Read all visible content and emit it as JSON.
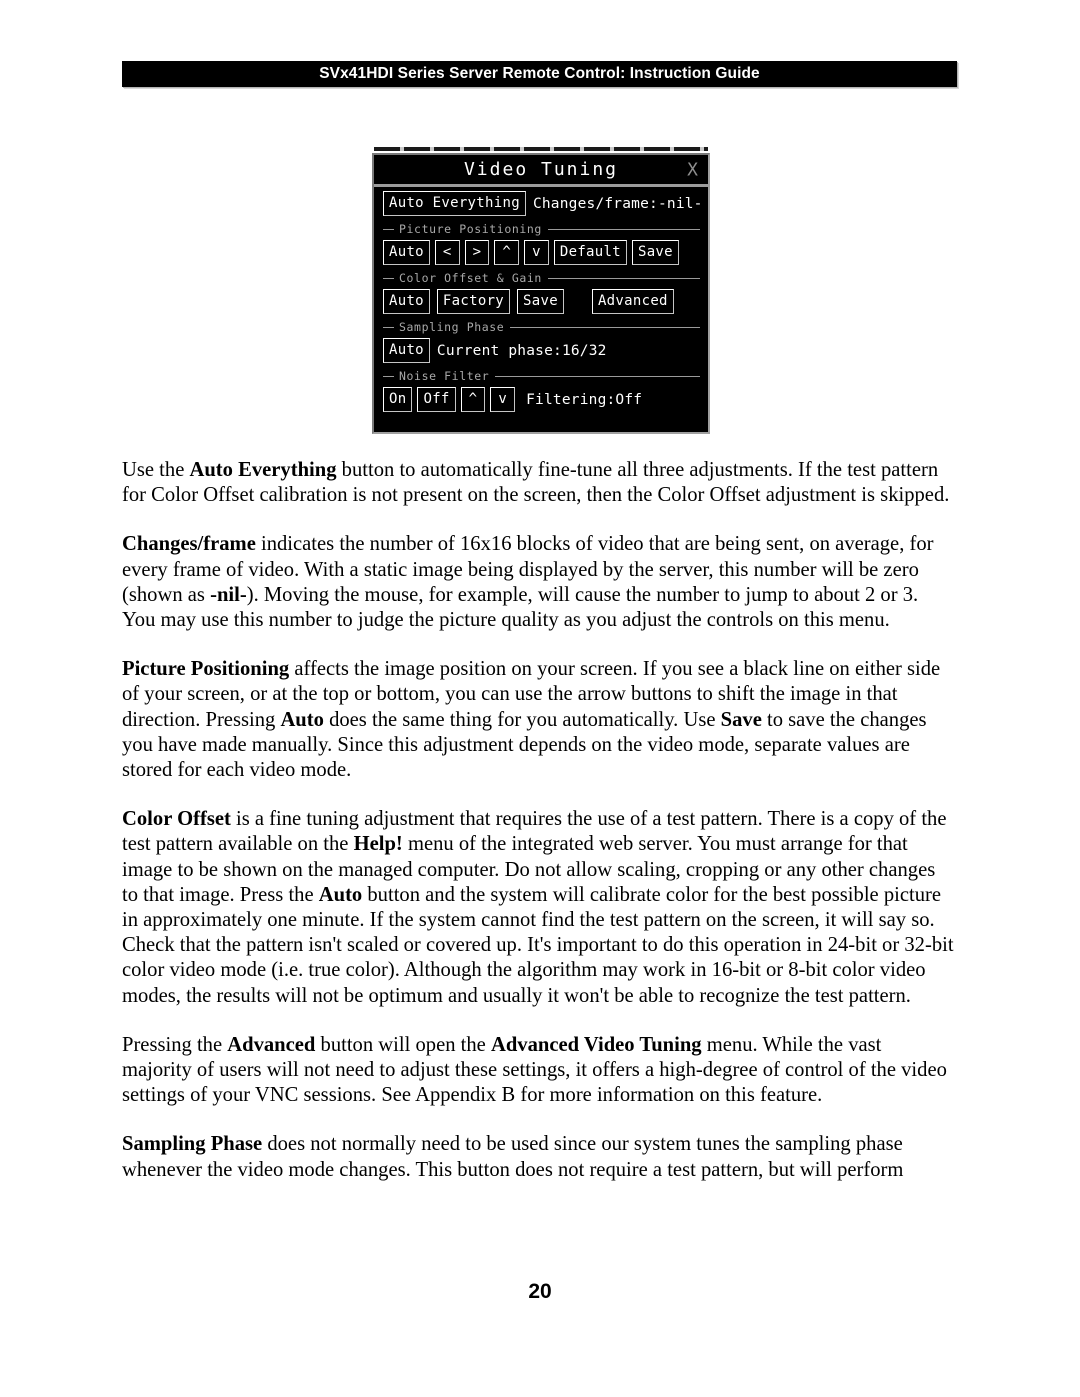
{
  "header": {
    "title": "SVx41HDI Series Server Remote Control: Instruction Guide"
  },
  "dialog": {
    "title": "Video Tuning",
    "close_label": "X",
    "row_auto_everything": {
      "button": "Auto Everything",
      "status": "Changes/frame:-nil-"
    },
    "groups": [
      {
        "caption": "Picture Positioning",
        "buttons": [
          "Auto",
          "<",
          ">",
          "^",
          "v",
          "Default",
          "Save"
        ]
      },
      {
        "caption": "Color Offset & Gain",
        "buttons": [
          "Auto",
          "Factory",
          "Save",
          "Advanced"
        ]
      },
      {
        "caption": "Sampling Phase",
        "buttons": [
          "Auto"
        ],
        "status": "Current phase:16/32"
      },
      {
        "caption": "Noise Filter",
        "buttons": [
          "On",
          "Off",
          "^",
          "v"
        ],
        "status": "Filtering:Off"
      }
    ]
  },
  "body": {
    "paragraphs": [
      {
        "id": "p-auto-everything",
        "html": "Use the <b>Auto Everything</b> button to automatically fine-tune all three adjustments. If the test pattern for Color Offset calibration is not present on the screen, then the Color Offset adjustment is skipped."
      },
      {
        "id": "p-changes-frame",
        "html": "<b>Changes/frame</b> indicates the number of 16x16 blocks of video that are being sent, on average, for every frame of video. With a static image being displayed by the server, this number will be zero (shown as <b>-nil-</b>). Moving the mouse, for example, will cause the number to jump to about 2 or 3. You may use this number to judge the picture quality as you adjust the controls on this menu."
      },
      {
        "id": "p-picture-positioning",
        "html": "<b>Picture Positioning</b> affects the image position on your screen. If you see a black line on either side of your screen, or at the top or bottom, you can use the arrow buttons to shift the image in that direction. Pressing <b>Auto</b> does the same thing for you automatically. Use <b>Save</b> to save the changes you have made manually. Since this adjustment depends on the video mode, separate values are stored for each video mode."
      },
      {
        "id": "p-color-offset",
        "html": "<b>Color Offset</b> is a fine tuning adjustment that requires the use of a test pattern.  There is a copy of the test pattern available on the <b>Help!</b> menu of the integrated web server. You must arrange for that image to be shown on the managed computer.  Do not allow scaling, cropping or any other changes to that image. Press the <b>Auto</b> button and the system will calibrate color for the best possible picture in approximately one minute. If the system cannot find the test pattern on the screen, it will say so.  Check that the pattern isn't scaled or covered up. It's important to do this operation in 24-bit or 32-bit color video mode (i.e. true color). Although the algorithm may work in 16-bit or 8-bit color video modes, the results will not be optimum and usually it won't be able to recognize the test pattern."
      },
      {
        "id": "p-advanced",
        "html": "Pressing the <b>Advanced</b> button will open the <b>Advanced Video Tuning</b> menu.  While the vast majority of users will not need to adjust these settings, it offers a high-degree of control of the video settings of your VNC sessions.  See Appendix B for more information on this feature."
      },
      {
        "id": "p-sampling-phase",
        "html": "<b>Sampling Phase</b> does not normally need to be used since our system tunes the sampling phase whenever the video mode changes. This button does not require a test pattern, but will perform"
      }
    ]
  },
  "footer": {
    "page_number": "20"
  },
  "colors": {
    "header_bg": "#000000",
    "header_text": "#ffffff",
    "dialog_bg": "#000000",
    "dialog_border": "#7a7a7a",
    "dialog_text": "#ffffff",
    "group_caption": "#a8a8a8",
    "page_bg": "#ffffff",
    "body_text": "#000000"
  }
}
